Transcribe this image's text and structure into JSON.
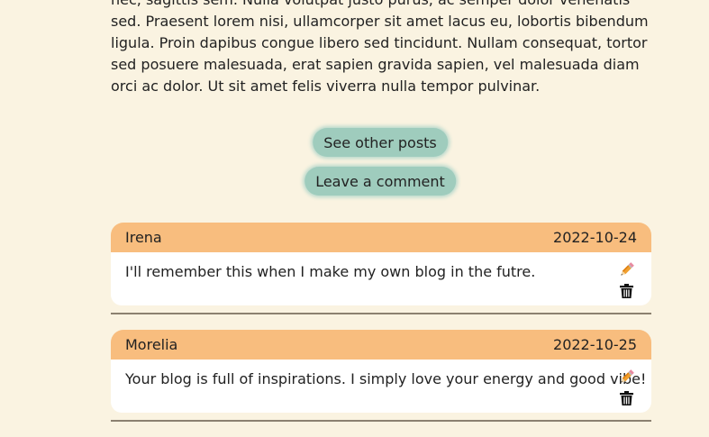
{
  "post": {
    "body": "nec, sagittis sem. Nulla volutpat justo purus, ac semper dolor venenatis sed. Praesent lorem nisi, ullamcorper sit amet lacus eu, lobortis bibendum ligula. Proin dapibus congue libero sed tincidunt. Nullam consequat, tortor sed posuere malesuada, erat sapien gravida sapien, vel malesuada diam orci ac dolor. Ut sit amet felis viverra nulla tempor pulvinar."
  },
  "actions": {
    "see_other_posts": "See other posts",
    "leave_comment": "Leave a comment"
  },
  "comments": [
    {
      "author": "Irena",
      "date": "2022-10-24",
      "text": "I'll remember this when I make my own blog in the futre.",
      "edit_icon": "pencil-icon",
      "delete_icon": "trash-icon"
    },
    {
      "author": "Morelia",
      "date": "2022-10-25",
      "text": "Your blog is full of inspirations. I simply love your energy and good vibe!",
      "edit_icon": "pencil-icon",
      "delete_icon": "trash-icon"
    }
  ],
  "colors": {
    "background": "#faf3e1",
    "button": "#9fccbd",
    "comment_header": "#f8bd7e",
    "comment_body": "#ffffff",
    "divider": "#8b8170"
  }
}
